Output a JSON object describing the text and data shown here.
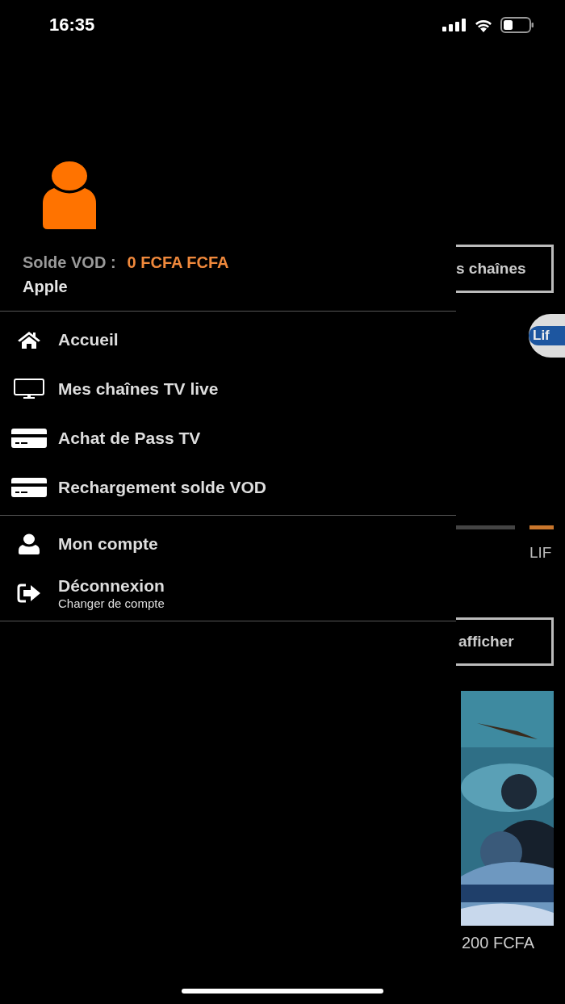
{
  "status_bar": {
    "time": "16:35"
  },
  "drawer": {
    "balance_label": "Solde VOD :",
    "balance_value": "0 FCFA FCFA",
    "user_name": "Apple",
    "sections": [
      {
        "items": [
          {
            "kind": "home",
            "label": "Accueil"
          },
          {
            "kind": "tv",
            "label": "Mes chaînes TV live"
          },
          {
            "kind": "card",
            "label": "Achat de Pass TV"
          },
          {
            "kind": "card",
            "label": "Rechargement solde VOD"
          }
        ]
      },
      {
        "items": [
          {
            "kind": "user",
            "label": "Mon compte"
          },
          {
            "kind": "logout",
            "label": "Déconnexion",
            "subtitle": "Changer de compte"
          }
        ]
      }
    ]
  },
  "background": {
    "channels_button": "s chaînes",
    "channel_logo_text": "Lif",
    "indicators": [
      {
        "selected": false
      },
      {
        "selected": true
      }
    ],
    "category_label": "LIF",
    "show_button": "afficher",
    "price": "200 FCFA"
  }
}
